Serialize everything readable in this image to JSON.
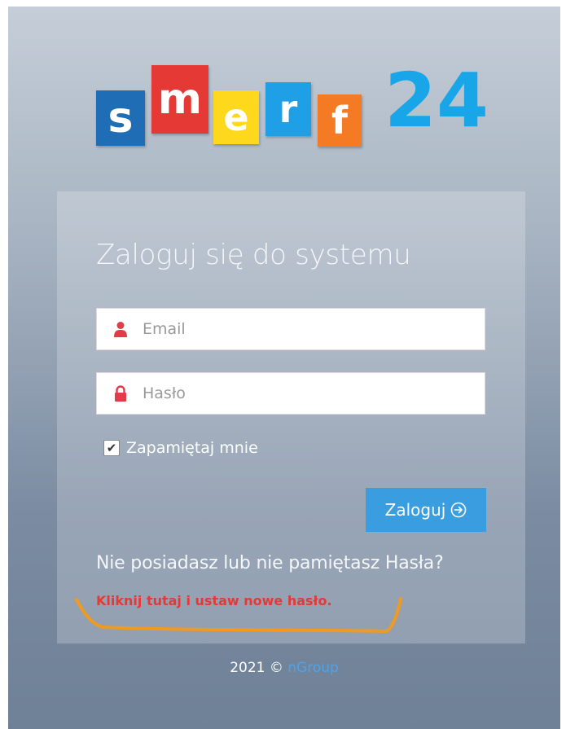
{
  "logo": {
    "letters": [
      "s",
      "m",
      "e",
      "r",
      "f"
    ],
    "number": "24",
    "colors": [
      "#1f6db4",
      "#e53935",
      "#fdd81c",
      "#1e9fe6",
      "#f47a24",
      "#19a6e8"
    ]
  },
  "login": {
    "title": "Zaloguj się do systemu",
    "email_placeholder": "Email",
    "email_icon": "user-icon",
    "password_placeholder": "Hasło",
    "password_icon": "lock-icon",
    "remember_label": "Zapamiętaj mnie",
    "remember_checked": true,
    "submit_label": "Zaloguj",
    "submit_icon": "circle-arrow-right-icon",
    "forgot_text": "Nie posiadasz lub nie pamiętasz Hasła?",
    "reset_link": "Kliknij tutaj i ustaw nowe hasło."
  },
  "footer": {
    "text": "2021 ©",
    "link": "nGroup"
  },
  "annotation": {
    "color": "#f29a1d"
  },
  "theme": {
    "accent": "#3a9de0",
    "danger": "#e53935",
    "link": "#4da3ea"
  }
}
